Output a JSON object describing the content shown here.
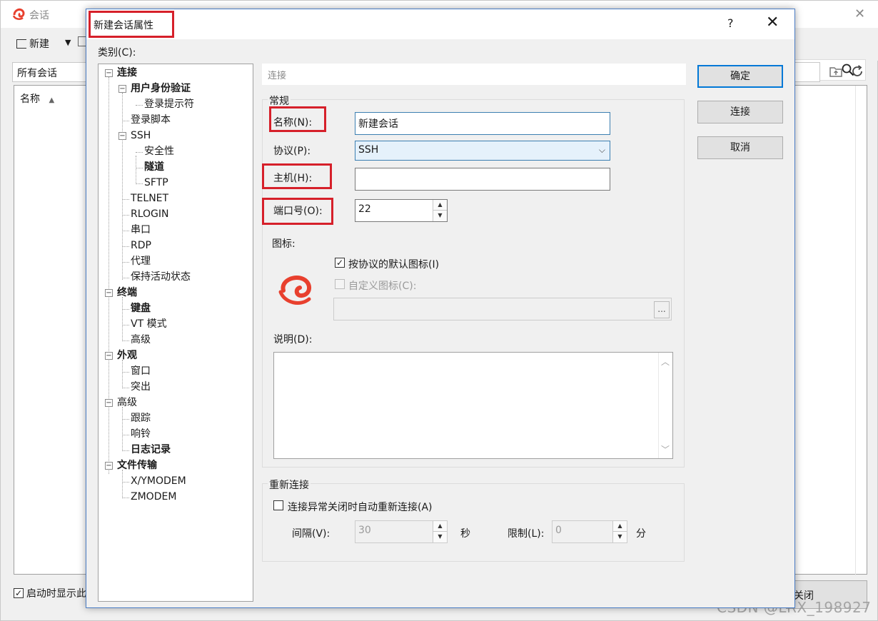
{
  "background_window": {
    "title": "会话",
    "toolbar": {
      "new_label": "新建"
    },
    "path": "所有会话",
    "list_header_name": "名称",
    "startup_checkbox_label": "启动时显示此",
    "close_label": "关闭",
    "watermark": "CSDN @LRX_198927"
  },
  "dialog": {
    "title": "新建会话属性",
    "help": "?",
    "close": "✕",
    "category_label": "类别(C):",
    "tree": [
      {
        "label": "连接",
        "bold": true,
        "level": 0,
        "expander": "−"
      },
      {
        "label": "用户身份验证",
        "bold": true,
        "level": 1,
        "expander": "−"
      },
      {
        "label": "登录提示符",
        "bold": false,
        "level": 2
      },
      {
        "label": "登录脚本",
        "bold": false,
        "level": 1
      },
      {
        "label": "SSH",
        "bold": false,
        "level": 1,
        "expander": "−"
      },
      {
        "label": "安全性",
        "bold": false,
        "level": 2
      },
      {
        "label": "隧道",
        "bold": true,
        "level": 2
      },
      {
        "label": "SFTP",
        "bold": false,
        "level": 2
      },
      {
        "label": "TELNET",
        "bold": false,
        "level": 1
      },
      {
        "label": "RLOGIN",
        "bold": false,
        "level": 1
      },
      {
        "label": "串口",
        "bold": false,
        "level": 1
      },
      {
        "label": "RDP",
        "bold": false,
        "level": 1
      },
      {
        "label": "代理",
        "bold": false,
        "level": 1
      },
      {
        "label": "保持活动状态",
        "bold": false,
        "level": 1
      },
      {
        "label": "终端",
        "bold": true,
        "level": 0,
        "expander": "−"
      },
      {
        "label": "键盘",
        "bold": true,
        "level": 1
      },
      {
        "label": "VT 模式",
        "bold": false,
        "level": 1
      },
      {
        "label": "高级",
        "bold": false,
        "level": 1
      },
      {
        "label": "外观",
        "bold": true,
        "level": 0,
        "expander": "−"
      },
      {
        "label": "窗口",
        "bold": false,
        "level": 1
      },
      {
        "label": "突出",
        "bold": false,
        "level": 1
      },
      {
        "label": "高级",
        "bold": false,
        "level": 0,
        "expander": "−"
      },
      {
        "label": "跟踪",
        "bold": false,
        "level": 1
      },
      {
        "label": "响铃",
        "bold": false,
        "level": 1
      },
      {
        "label": "日志记录",
        "bold": true,
        "level": 1
      },
      {
        "label": "文件传输",
        "bold": true,
        "level": 0,
        "expander": "−"
      },
      {
        "label": "X/YMODEM",
        "bold": false,
        "level": 1
      },
      {
        "label": "ZMODEM",
        "bold": false,
        "level": 1
      }
    ],
    "panel_header": "连接",
    "general": {
      "legend": "常规",
      "name_label": "名称(N):",
      "name_value": "新建会话",
      "protocol_label": "协议(P):",
      "protocol_value": "SSH",
      "host_label": "主机(H):",
      "host_value": "",
      "port_label": "端口号(O):",
      "port_value": "22",
      "icon_label": "图标:",
      "default_icon_label": "按协议的默认图标(I)",
      "default_icon_checked": true,
      "custom_icon_label": "自定义图标(C):",
      "custom_icon_checked": false,
      "browse": "...",
      "description_label": "说明(D):",
      "description_value": ""
    },
    "reconnect": {
      "legend": "重新连接",
      "auto_reconnect_label": "连接异常关闭时自动重新连接(A)",
      "auto_reconnect_checked": false,
      "interval_label": "间隔(V):",
      "interval_value": "30",
      "interval_unit": "秒",
      "limit_label": "限制(L):",
      "limit_value": "0",
      "limit_unit": "分"
    },
    "buttons": {
      "ok": "确定",
      "connect": "连接",
      "cancel": "取消"
    }
  },
  "colors": {
    "highlight_box": "#d6202a",
    "selection": "#3778d2",
    "logo": "#e8402e"
  }
}
